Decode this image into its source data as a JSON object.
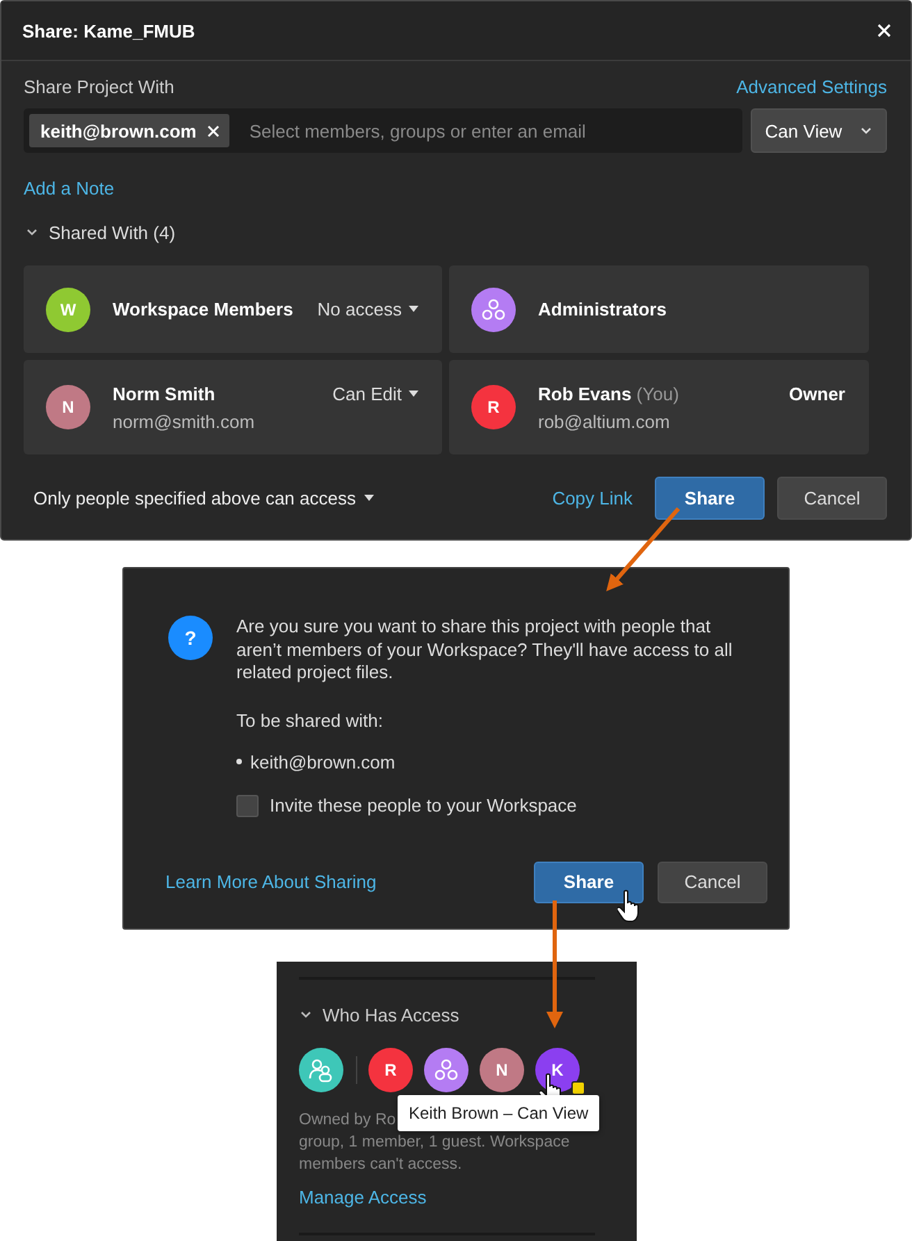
{
  "dialog": {
    "title": "Share: Kame_FMUB",
    "share_label": "Share Project With",
    "advanced_link": "Advanced Settings",
    "chips": [
      "keith@brown.com"
    ],
    "placeholder": "Select members, groups or enter an email",
    "permission": "Can View",
    "add_note": "Add a Note",
    "shared_heading": "Shared With (4)",
    "expanded": true,
    "members": [
      {
        "kind": "letter",
        "initial": "W",
        "color": "#8fc932",
        "name": "Workspace Members",
        "role": "No access",
        "dropdown": true
      },
      {
        "kind": "group",
        "color": "#b47cf3",
        "name": "Administrators"
      },
      {
        "kind": "letter",
        "initial": "N",
        "color": "#c07985",
        "name": "Norm Smith",
        "email": "norm@smith.com",
        "role": "Can Edit",
        "dropdown": true
      },
      {
        "kind": "letter",
        "initial": "R",
        "color": "#f4333f",
        "name": "Rob Evans",
        "suffix": "(You)",
        "email": "rob@altium.com",
        "role": "Owner",
        "dropdown": false
      }
    ],
    "access_mode": "Only people specified above can access",
    "copy_link": "Copy Link",
    "buttons": [
      {
        "label": "Share",
        "kind": "primary"
      },
      {
        "label": "Cancel",
        "kind": "secondary"
      }
    ]
  },
  "confirm": {
    "icon": "?",
    "message": "Are you sure you want to share this project with people that aren’t members of your Workspace? They'll have access to all related project files.",
    "shared_label": "To be shared with:",
    "recipients": [
      "keith@brown.com"
    ],
    "invite": {
      "label": "Invite these people to your Workspace",
      "checked": false
    },
    "learn_link": "Learn More About Sharing",
    "buttons": [
      {
        "label": "Share",
        "kind": "primary"
      },
      {
        "label": "Cancel",
        "kind": "secondary"
      }
    ]
  },
  "panel": {
    "heading": "Who Has Access",
    "expanded": true,
    "avatars": [
      {
        "kind": "members",
        "color": "#3ec7b8"
      },
      {
        "kind": "letter",
        "initial": "R",
        "color": "#f4333f"
      },
      {
        "kind": "group",
        "color": "#b47cf3"
      },
      {
        "kind": "letter",
        "initial": "N",
        "color": "#c07985"
      },
      {
        "kind": "letter",
        "initial": "K",
        "color": "#8b3ff0",
        "badge": {
          "color": "#f2d200"
        }
      }
    ],
    "tooltip": "Keith Brown – Can View",
    "summary_lines": [
      "Owned by Ro",
      "group, 1 member, 1 guest. Workspace",
      "members can't access."
    ],
    "manage_link": "Manage Access"
  }
}
